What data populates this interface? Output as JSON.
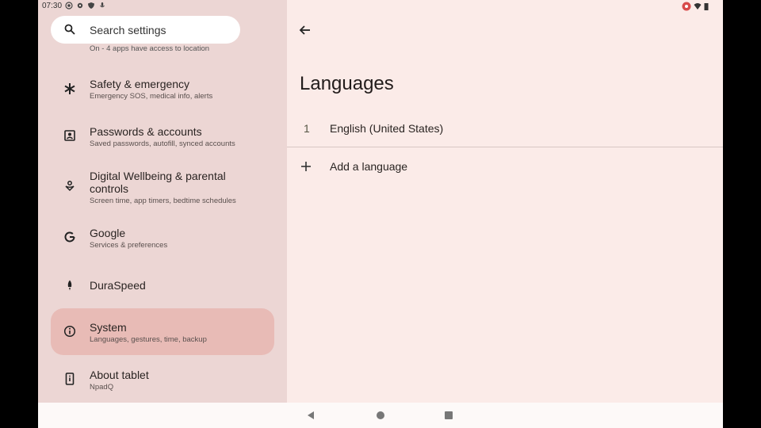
{
  "status_bar": {
    "time": "07:30"
  },
  "search": {
    "placeholder": "Search settings"
  },
  "clipped_subtitle": "On - 4 apps have access to location",
  "sidebar": {
    "items": [
      {
        "title": "Safety & emergency",
        "subtitle": "Emergency SOS, medical info, alerts",
        "icon": "asterisk-icon"
      },
      {
        "title": "Passwords & accounts",
        "subtitle": "Saved passwords, autofill, synced accounts",
        "icon": "account-box-icon"
      },
      {
        "title": "Digital Wellbeing & parental",
        "title2": "controls",
        "subtitle": "Screen time, app timers, bedtime schedules",
        "icon": "wellbeing-icon"
      },
      {
        "title": "Google",
        "subtitle": "Services & preferences",
        "icon": "google-icon"
      },
      {
        "title": "DuraSpeed",
        "subtitle": "",
        "icon": "rocket-icon"
      },
      {
        "title": "System",
        "subtitle": "Languages, gestures, time, backup",
        "icon": "info-icon",
        "active": true
      },
      {
        "title": "About tablet",
        "subtitle": "NpadQ",
        "icon": "tablet-icon"
      }
    ]
  },
  "main": {
    "title": "Languages",
    "languages": [
      {
        "index": "1",
        "name": "English (United States)"
      }
    ],
    "add_label": "Add a language"
  },
  "colors": {
    "active_bg": "#e8bbb6",
    "left_bg": "#ecd6d4",
    "right_bg": "#fbebe8"
  }
}
